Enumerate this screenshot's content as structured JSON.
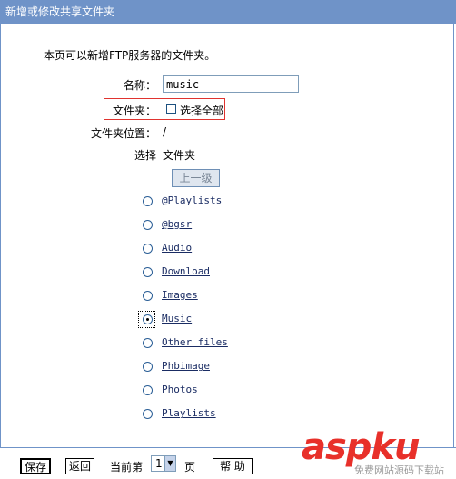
{
  "window": {
    "title": "新增或修改共享文件夹"
  },
  "form": {
    "intro": "本页可以新增FTP服务器的文件夹。",
    "name_label": "名称：",
    "name_value": "music",
    "folder_label": "文件夹：",
    "select_all_label": "选择全部",
    "location_label": "文件夹位置：",
    "location_value": "/",
    "column_select": "选择",
    "column_folder": "文件夹",
    "up_button": "上一级"
  },
  "folders": [
    {
      "name": "@Playlists",
      "selected": false
    },
    {
      "name": "@bgsr",
      "selected": false
    },
    {
      "name": "Audio",
      "selected": false
    },
    {
      "name": "Download",
      "selected": false
    },
    {
      "name": "Images",
      "selected": false
    },
    {
      "name": "Music",
      "selected": true
    },
    {
      "name": "Other files",
      "selected": false
    },
    {
      "name": "Phbimage",
      "selected": false
    },
    {
      "name": "Photos",
      "selected": false
    },
    {
      "name": "Playlists",
      "selected": false
    }
  ],
  "footer": {
    "save": "保存",
    "back": "返回",
    "current_page_prefix": "当前第",
    "current_page": "1",
    "current_page_suffix": "页",
    "help": "帮 助"
  },
  "watermark": {
    "main": "aspku",
    "sub": "免费网站源码下载站"
  },
  "colors": {
    "titlebar": "#6f93c8",
    "highlight": "#e0332f",
    "link": "#1a2c63",
    "logo": "#e8302a"
  }
}
